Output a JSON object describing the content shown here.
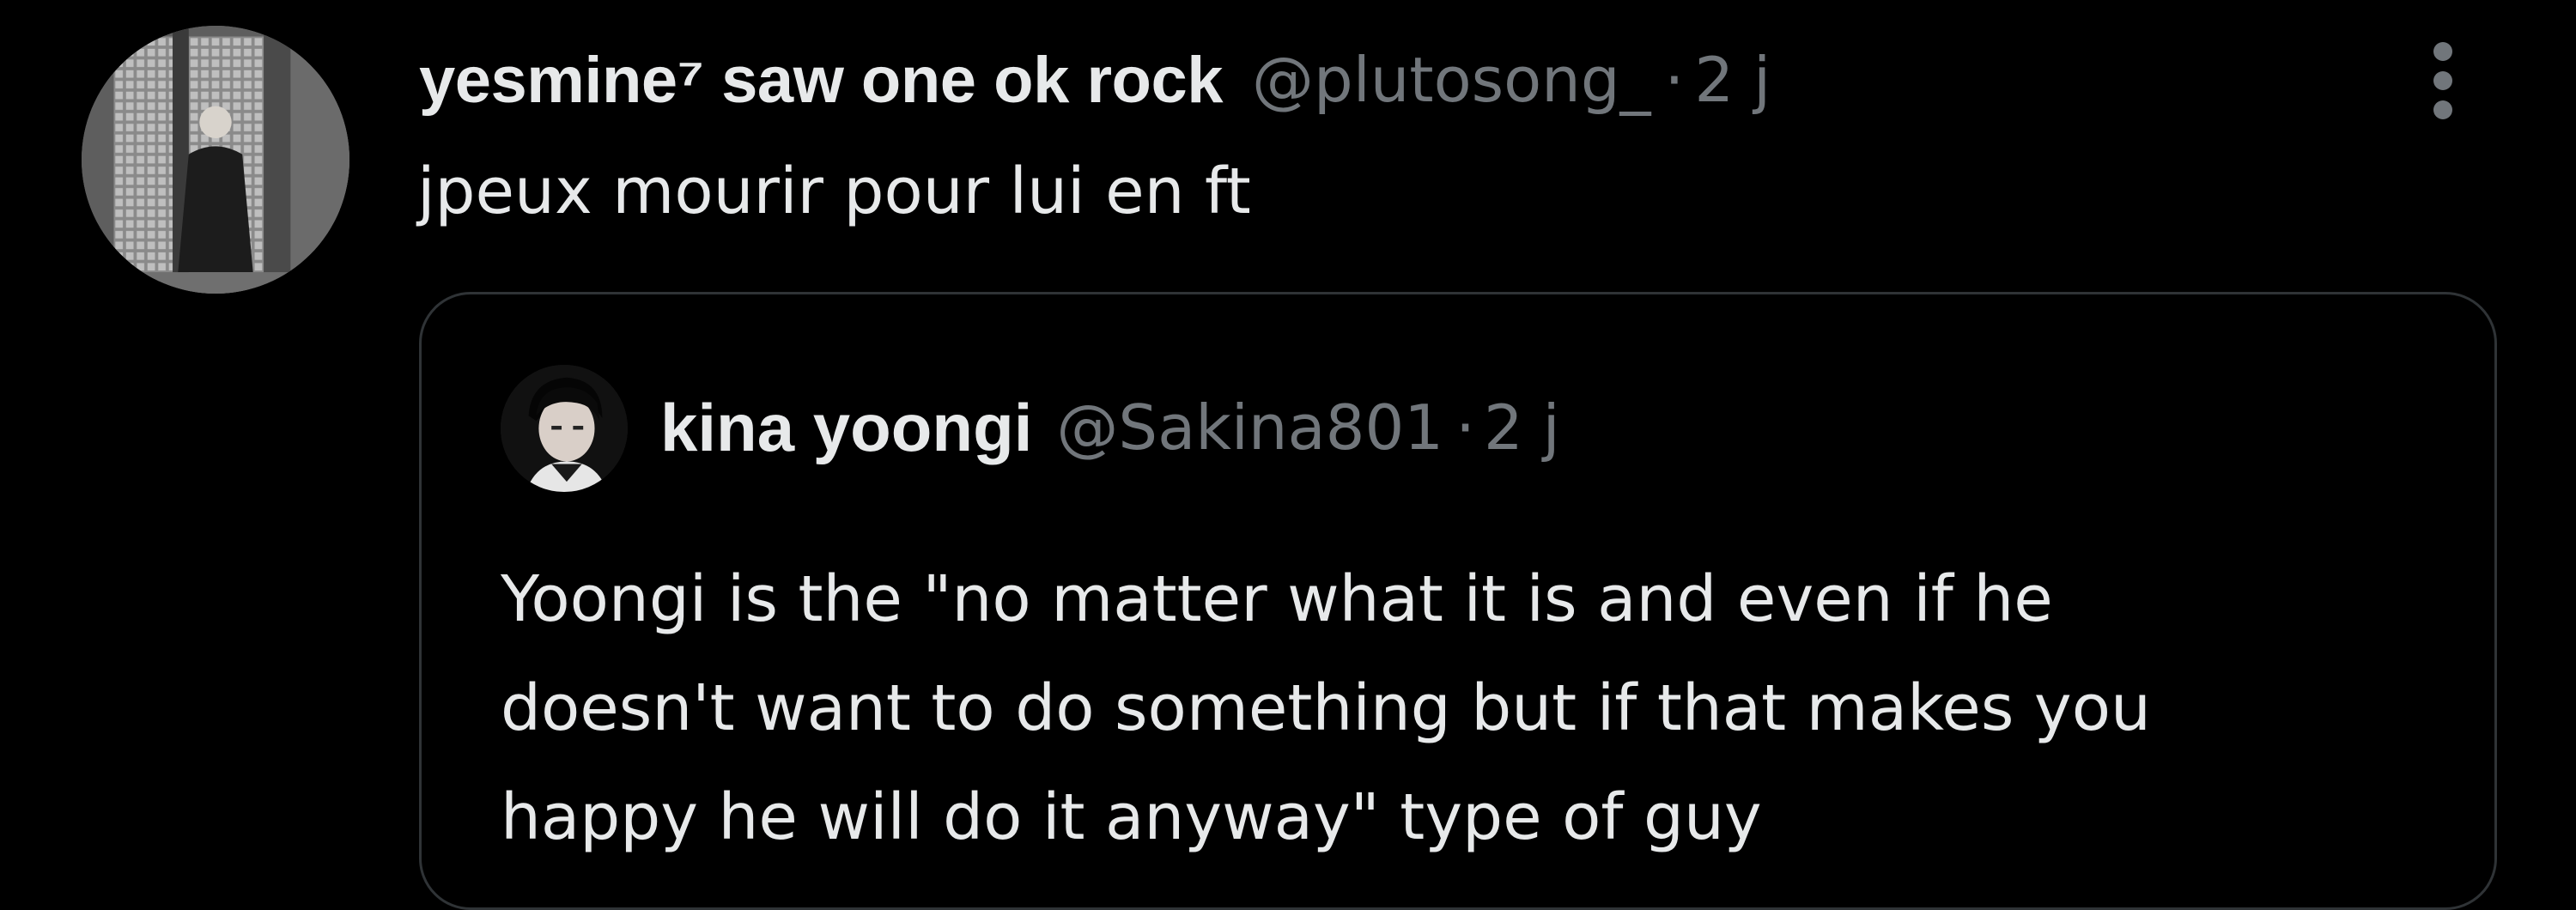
{
  "tweet": {
    "author": {
      "display_name": "yesmine⁷ saw one ok rock",
      "handle": "@plutosong_",
      "separator": "·",
      "time": "2 j"
    },
    "text": "jpeux mourir pour lui en ft",
    "more_icon": "kebab-vertical-icon"
  },
  "quoted_tweet": {
    "author": {
      "display_name": "kina yoongi",
      "handle": "@Sakina801",
      "separator": "·",
      "time": "2 j"
    },
    "text_lines": [
      "Yoongi is the \"no matter what it is and even if he",
      "doesn't want to do something but if that makes you",
      "happy he will do it anyway\" type of guy"
    ]
  },
  "colors": {
    "background": "#000000",
    "primary_text": "#e7e9ea",
    "secondary_text": "#71767b",
    "border": "#2f3336"
  }
}
